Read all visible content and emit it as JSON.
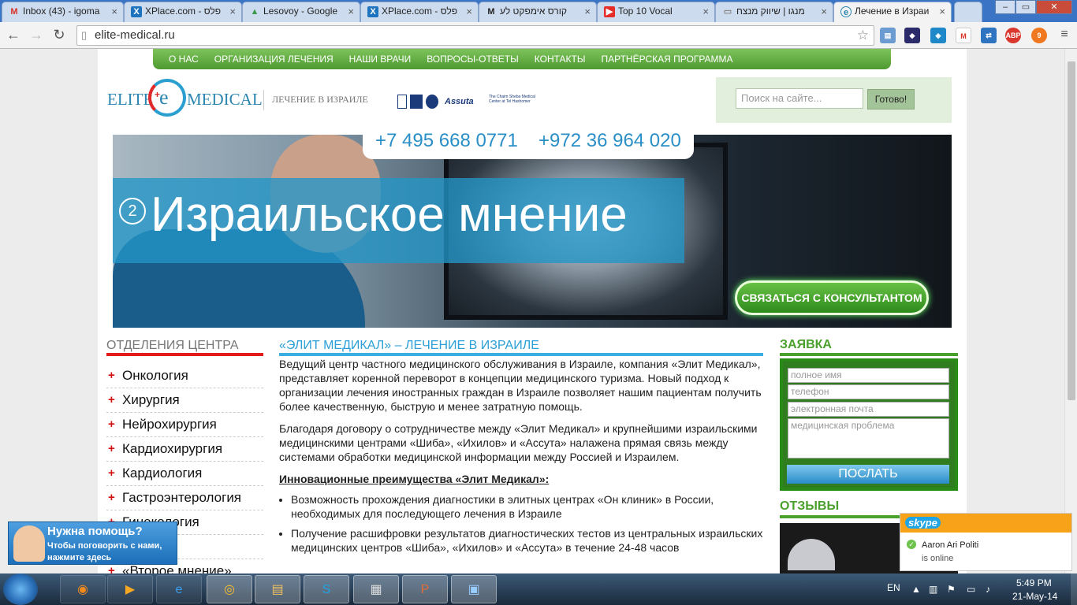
{
  "browser": {
    "tabs": [
      {
        "title": "Inbox (43) - igoma",
        "icon": "gmail-icon",
        "icon_char": "M",
        "icon_color": "#d93025"
      },
      {
        "title": "XPlace.com - פלס",
        "icon": "xplace-icon",
        "icon_char": "X",
        "icon_color": "#1e73be"
      },
      {
        "title": "Lesovoy - Google",
        "icon": "google-drive-icon",
        "icon_char": "▲",
        "icon_color": "#3c9a4f"
      },
      {
        "title": "XPlace.com - פלס",
        "icon": "xplace-icon",
        "icon_char": "X",
        "icon_color": "#1e73be"
      },
      {
        "title": "קורס אימפקט לע",
        "icon": "m-site-icon",
        "icon_char": "M",
        "icon_color": "#333333"
      },
      {
        "title": "Top 10 Vocal",
        "icon": "youtube-icon",
        "icon_char": "▶",
        "icon_color": "#e52d27"
      },
      {
        "title": "מנגו | שיווק מנצח",
        "icon": "page-icon",
        "icon_char": "▭",
        "icon_color": "#888888"
      },
      {
        "title": "Лечение в Израи",
        "icon": "elite-medical-icon",
        "icon_char": "e",
        "icon_color": "#2a86b0"
      }
    ],
    "url": "elite-medical.ru",
    "extensions": [
      "folder",
      "bat",
      "app",
      "gmail",
      "sync",
      "ABP",
      "9"
    ]
  },
  "site": {
    "nav": [
      "О НАС",
      "ОРГАНИЗАЦИЯ ЛЕЧЕНИЯ",
      "НАШИ ВРАЧИ",
      "ВОПРОСЫ-ОТВЕТЫ",
      "КОНТАКТЫ",
      "ПАРТНЁРСКАЯ ПРОГРАММА"
    ],
    "logo_left": "ELITE",
    "logo_right": "MEDICAL",
    "tagline": "ЛЕЧЕНИЕ В ИЗРАИЛЕ",
    "partners": [
      "Assuta",
      "The Chaim Sheba Medical Center at Tel Hashomer"
    ],
    "search_placeholder": "Поиск на сайте...",
    "search_button": "Готово!",
    "phone1": "+7 495 668 0771",
    "phone2": "+972 36 964 020",
    "hero_number": "2",
    "hero_title": "Израильское мнение",
    "hero_cta": "СВЯЗАТЬСЯ С КОНСУЛЬТАНТОМ",
    "left_heading": "ОТДЕЛЕНИЯ ЦЕНТРА",
    "departments": [
      "Онкология",
      "Хирургия",
      "Нейрохирургия",
      "Кардиохирургия",
      "Кардиология",
      "Гастроэнтерология",
      "Гинекология",
      "…тика",
      "«Второе мнение»"
    ],
    "main_heading": "«ЭЛИТ МЕДИКАЛ» – ЛЕЧЕНИЕ В ИЗРАИЛЕ",
    "para1": "Ведущий центр частного медицинского обслуживания в Израиле, компания «Элит Медикал»,  представляет коренной переворот в концепции медицинского туризма. Новый подход к организации лечения иностранных граждан в Израиле позволяет нашим пациентам получить более качественную, быструю и менее затратную помощь.",
    "para2": "Благодаря договору о сотрудничестве между «Элит Медикал» и крупнейшими израильскими медицинскими центрами «Шиба», «Ихилов» и «Ассута» налажена прямая связь между системами обработки медицинской информации между Россией и Израилем.",
    "advantages_heading": "Инновационные преимущества «Элит Медикал»:",
    "advantages": [
      "Возможность прохождения диагностики в элитных центрах «Он клиник» в России, необходимых для последующего лечения в Израиле",
      "Получение расшифровки результатов диагностических тестов из центральных израильских медицинских центров «Шиба», «Ихилов» и «Ассута» в течение 24-48 часов"
    ],
    "form_heading": "ЗАЯВКА",
    "form_fields": [
      "полное имя",
      "телефон",
      "электронная почта",
      "медицинская проблема"
    ],
    "form_submit": "ПОСЛАТЬ",
    "reviews_heading": "ОТЗЫВЫ"
  },
  "help_widget": {
    "title": "Нужна помощь?",
    "text": "Чтобы поговорить с нами, нажмите здесь"
  },
  "skype": {
    "brand": "skype",
    "name": "Aaron Ari Politi",
    "status": "is online"
  },
  "taskbar": {
    "apps": [
      "firefox",
      "media",
      "ie",
      "chrome",
      "explorer",
      "skype",
      "calculator",
      "powerpoint",
      "screen"
    ],
    "lang": "EN",
    "time": "5:49 PM",
    "date": "21-May-14"
  }
}
